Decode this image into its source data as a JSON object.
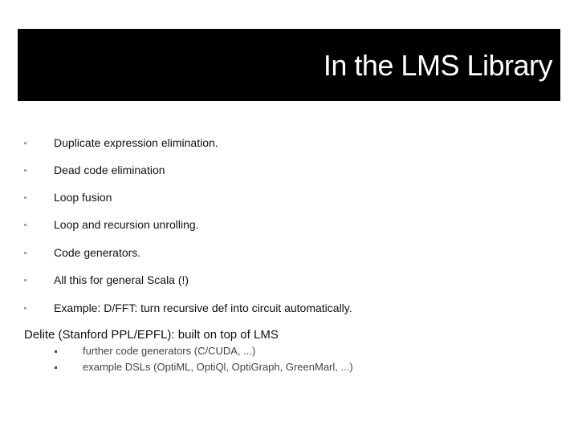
{
  "slide": {
    "title": "In the LMS Library",
    "bullets": [
      "Duplicate expression elimination.",
      "Dead code elimination",
      "Loop fusion",
      "Loop and recursion unrolling.",
      "Code generators.",
      "All this for general Scala (!)",
      "Example: D/FFT: turn recursive def into circuit automatically."
    ],
    "delite": {
      "text": "Delite (Stanford PPL/EPFL): built on top of LMS",
      "sub_bullets": [
        "further code generators (C/CUDA, ...)",
        "example DSLs (OptiML, OptiQl, OptiGraph, GreenMarl, ...)"
      ]
    }
  }
}
